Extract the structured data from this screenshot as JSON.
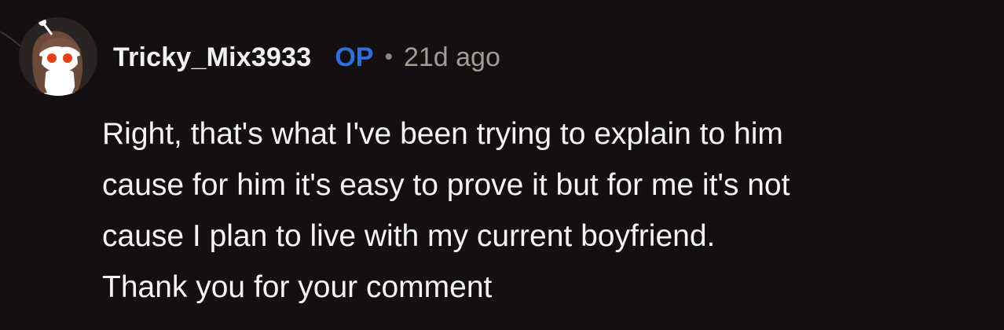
{
  "comment": {
    "author": {
      "username": "Tricky_Mix3933",
      "avatar_icon": "snoo-avatar-icon"
    },
    "op_badge": "OP",
    "separator": "•",
    "timestamp": "21d ago",
    "body_lines": [
      "Right, that's what I've been trying to explain to him",
      "cause for him it's easy to prove it but for me it's not",
      "cause I plan to live with my current boyfriend.",
      "Thank you for your comment"
    ]
  },
  "colors": {
    "background": "#141011",
    "username": "#f2f2f2",
    "op_badge": "#2f6fe0",
    "timestamp": "#a39c95",
    "body_text": "#f4f4f4"
  }
}
